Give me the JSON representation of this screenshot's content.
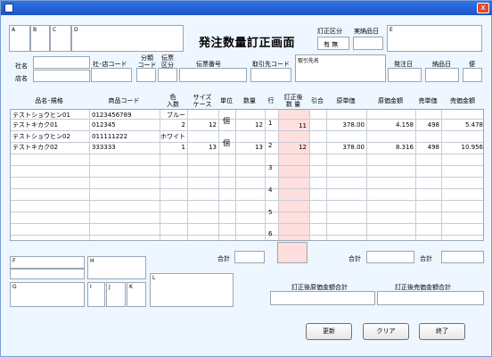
{
  "window": {
    "close_glyph": "x",
    "icon": "app-window-icon"
  },
  "title": "発注数量訂正画面",
  "top_boxes": {
    "a": "A",
    "b": "B",
    "c": "C",
    "d": "D",
    "e": "E"
  },
  "correction": {
    "label": "訂正区分",
    "value": "有 無"
  },
  "actual_date": {
    "label": "実納品日"
  },
  "header_fields": {
    "company_name": "社名",
    "store_name": "店名",
    "company_store_code": "社･店コード",
    "class_code_1": "分類",
    "class_code_2": "コード",
    "voucher_type_1": "伝票",
    "voucher_type_2": "区分",
    "voucher_number": "伝票番号",
    "supplier_code": "取引先コード",
    "supplier_name": "取引先名",
    "order_date": "発注日",
    "delivery_date": "納品日",
    "flight": "便"
  },
  "columns": {
    "name": "品名･規格",
    "code": "商品コード",
    "color_1": "色",
    "color_2": "入数",
    "size_1": "サイズ",
    "size_2": "ケース",
    "unit": "単位",
    "qty": "数量",
    "row": "行",
    "corrected_1": "訂正後",
    "corrected_2": "数 量",
    "discount": "引合",
    "unit_cost": "原単価",
    "cost_amount": "原価金額",
    "unit_price": "売単価",
    "sales_amount": "売価金額"
  },
  "rows": [
    {
      "name": "テストショウヒン01",
      "name2": "テストキカク01",
      "code": "0123456789",
      "code2": "012345",
      "color": "ブルー",
      "pack": "2",
      "case": "12",
      "unit": "個",
      "qty": "12",
      "row": "1",
      "corrected": "11",
      "unit_cost": "378.00",
      "cost_amount": "4.158",
      "unit_price": "498",
      "sales_amount": "5.478"
    },
    {
      "name": "テストショウヒン02",
      "name2": "テストキカク02",
      "code": "011111222",
      "code2": "333333",
      "color": "ホワイト",
      "pack": "1",
      "case": "13",
      "unit": "個",
      "qty": "13",
      "row": "2",
      "corrected": "12",
      "unit_cost": "378.00",
      "cost_amount": "8.316",
      "unit_price": "498",
      "sales_amount": "10.956"
    }
  ],
  "row_numbers": [
    "3",
    "4",
    "5",
    "6"
  ],
  "totals": {
    "total_1": "合計",
    "total_2": "合計",
    "total_3": "合計"
  },
  "bottom_boxes": {
    "f": "F",
    "g": "G",
    "h": "H",
    "i": "I",
    "j": "J",
    "k": "K",
    "l": "L"
  },
  "corrected_totals": {
    "cost_label": "訂正後原価金額合計",
    "sales_label": "訂正後売価金額合計"
  },
  "buttons": {
    "update": "更新",
    "clear": "クリア",
    "exit": "終了"
  }
}
